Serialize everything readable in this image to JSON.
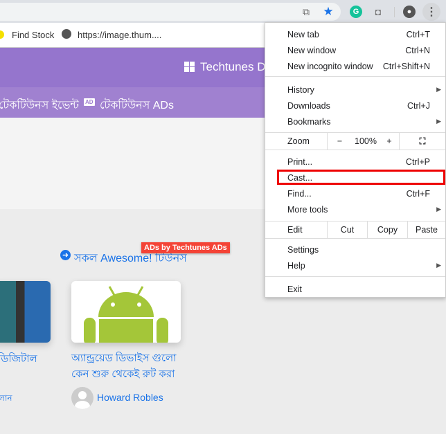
{
  "toolbar": {
    "icons": [
      "translate-icon",
      "bookmark-star-icon",
      "grammarly-icon",
      "screenshot-camera-icon",
      "profile-icon",
      "more-menu-icon"
    ]
  },
  "bookmarks": [
    {
      "label": "Find Stock"
    },
    {
      "label": "https://image.thum...."
    }
  ],
  "header": {
    "title": "Techtunes Di"
  },
  "nav": {
    "item1": "টেকটিউনস ইভেন্ট",
    "ad_badge": "AD",
    "item2": "টেকটিউনস ADs"
  },
  "content": {
    "all_link": "সকল Awesome! টিউনস",
    "ads_badge": "ADs by Techtunes ADs",
    "card1": {
      "title": "ডিজিটাল",
      "author": "লান"
    },
    "card2": {
      "title_line1": "অ্যান্ড্রয়েড ডিভাইস গুলো",
      "title_line2": "কেন শুরু থেকেই রুট করা",
      "author": "Howard Robles"
    }
  },
  "menu": {
    "new_tab": "New tab",
    "new_tab_sc": "Ctrl+T",
    "new_window": "New window",
    "new_window_sc": "Ctrl+N",
    "incognito": "New incognito window",
    "incognito_sc": "Ctrl+Shift+N",
    "history": "History",
    "downloads": "Downloads",
    "downloads_sc": "Ctrl+J",
    "bookmarks": "Bookmarks",
    "zoom": "Zoom",
    "zoom_minus": "−",
    "zoom_value": "100%",
    "zoom_plus": "+",
    "print": "Print...",
    "print_sc": "Ctrl+P",
    "cast": "Cast...",
    "find": "Find...",
    "find_sc": "Ctrl+F",
    "more_tools": "More tools",
    "edit": "Edit",
    "cut": "Cut",
    "copy": "Copy",
    "paste": "Paste",
    "settings": "Settings",
    "help": "Help",
    "exit": "Exit"
  },
  "colors": {
    "highlight": "#ee0000",
    "header": "#9575cd",
    "link": "#1a73e8",
    "ad": "#f44336"
  }
}
